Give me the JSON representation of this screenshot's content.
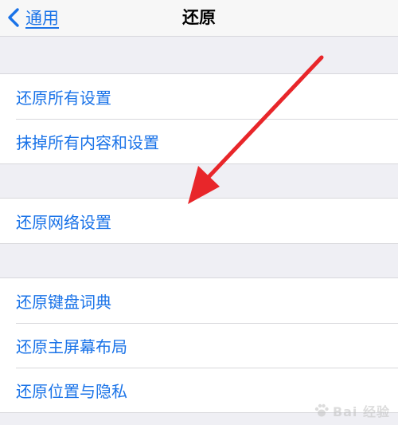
{
  "navbar": {
    "back_label": "通用",
    "title": "还原"
  },
  "groups": [
    {
      "items": [
        "还原所有设置",
        "抹掉所有内容和设置"
      ]
    },
    {
      "items": [
        "还原网络设置"
      ]
    },
    {
      "items": [
        "还原键盘词典",
        "还原主屏幕布局",
        "还原位置与隐私"
      ]
    }
  ],
  "annotation": {
    "arrow_color": "#e8262a"
  },
  "watermark": {
    "text": "Bai 经验"
  },
  "colors": {
    "accent": "#1a73e8",
    "background": "#efeff4"
  }
}
